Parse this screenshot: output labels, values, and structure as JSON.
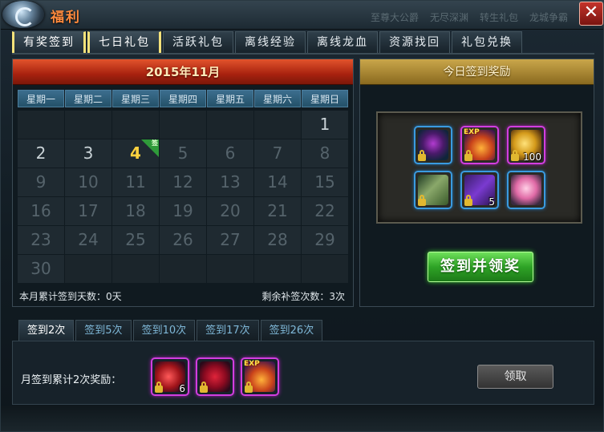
{
  "window": {
    "title": "福利",
    "background_tabs": [
      "至尊大公爵",
      "无尽深渊",
      "转生礼包",
      "龙城争霸"
    ],
    "close_label": "✕"
  },
  "main_tabs": [
    {
      "label": "有奖签到",
      "active": true
    },
    {
      "label": "七日礼包",
      "active": true
    },
    {
      "label": "活跃礼包",
      "active": false
    },
    {
      "label": "离线经验",
      "active": false
    },
    {
      "label": "离线龙血",
      "active": false
    },
    {
      "label": "资源找回",
      "active": false
    },
    {
      "label": "礼包兑换",
      "active": false
    }
  ],
  "calendar": {
    "month_title": "2015年11月",
    "weekdays": [
      "星期一",
      "星期二",
      "星期三",
      "星期四",
      "星期五",
      "星期六",
      "星期日"
    ],
    "leading_blanks": 6,
    "days_in_month": 30,
    "today": 4,
    "today_badge": "签",
    "total_cells": 42,
    "footer_left": "本月累计签到天数：0天",
    "footer_right": "剩余补签次数：3次"
  },
  "daily_reward": {
    "header": "今日签到奖励",
    "items": [
      {
        "icon": "demon-mask-icon",
        "rarity": "blue",
        "qty": "",
        "locked": true
      },
      {
        "icon": "exp-potion-icon",
        "rarity": "purple",
        "qty": "",
        "locked": true,
        "tag": "EXP"
      },
      {
        "icon": "gold-coins-icon",
        "rarity": "purple",
        "qty": "100",
        "locked": true
      },
      {
        "icon": "scroll-icon",
        "rarity": "blue",
        "qty": "",
        "locked": true
      },
      {
        "icon": "spellbook-icon",
        "rarity": "blue",
        "qty": "5",
        "locked": true
      },
      {
        "icon": "pink-flower-icon",
        "rarity": "blue",
        "qty": "",
        "locked": false
      }
    ],
    "sign_button": "签到并领奖"
  },
  "cumulative": {
    "tabs": [
      {
        "label": "签到2次",
        "active": true
      },
      {
        "label": "签到5次",
        "active": false
      },
      {
        "label": "签到10次",
        "active": false
      },
      {
        "label": "签到17次",
        "active": false
      },
      {
        "label": "签到26次",
        "active": false
      }
    ],
    "reward_label": "月签到累计2次奖励：",
    "items": [
      {
        "icon": "red-gem-icon",
        "rarity": "purple",
        "qty": "6",
        "locked": true
      },
      {
        "icon": "red-rune-icon",
        "rarity": "purple",
        "qty": "",
        "locked": true
      },
      {
        "icon": "exp-potion-icon",
        "rarity": "purple",
        "qty": "",
        "locked": true,
        "tag": "EXP"
      }
    ],
    "claim_button": "领取"
  }
}
